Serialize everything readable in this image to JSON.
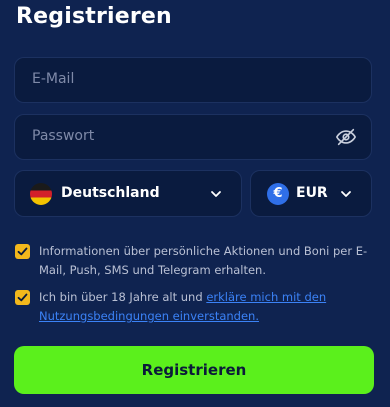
{
  "header": {
    "title": "Registrieren"
  },
  "form": {
    "email": {
      "placeholder": "E-Mail",
      "value": ""
    },
    "password": {
      "placeholder": "Passwort",
      "value": ""
    },
    "country": {
      "selected": "Deutschland",
      "flag_icon": "flag-germany-icon"
    },
    "currency": {
      "selected": "EUR",
      "icon": "euro-icon",
      "symbol": "€"
    },
    "consent": {
      "marketing_text": "Informationen über persönliche Aktionen und Boni per E-Mail, Push, SMS und Telegram erhalten.",
      "marketing_checked": true,
      "age_text": "Ich bin über 18 Jahre alt und ",
      "age_link": "erkläre mich mit den Nutzungsbedingungen einverstanden.",
      "age_checked": true
    },
    "submit_label": "Registrieren"
  },
  "colors": {
    "background": "#0f2350",
    "field": "#0a1b3f",
    "checkbox": "#f3b81c",
    "link": "#3b82f6",
    "submit": "#5bf01c"
  }
}
